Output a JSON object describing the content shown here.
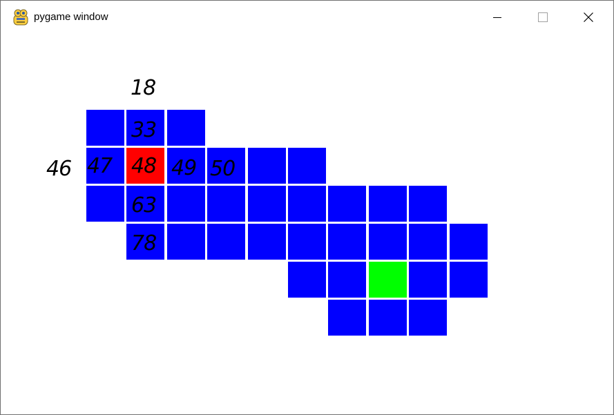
{
  "window": {
    "title": "pygame window",
    "icon": "pygame-snake-icon",
    "controls": {
      "minimize_icon": "minimize-icon",
      "maximize_icon": "maximize-icon",
      "close_icon": "close-icon"
    }
  },
  "colors": {
    "cell": "#0000ff",
    "selected": "#ff0000",
    "goal": "#00ff00",
    "background": "#ffffff",
    "gridline": "#ffffff"
  },
  "grid": {
    "rows": [
      {
        "row": 0,
        "cells": [
          {
            "col": 0,
            "state": "normal"
          },
          {
            "col": 1,
            "state": "normal"
          },
          {
            "col": 2,
            "state": "normal"
          }
        ]
      },
      {
        "row": 1,
        "cells": [
          {
            "col": 0,
            "state": "normal"
          },
          {
            "col": 1,
            "state": "selected"
          },
          {
            "col": 2,
            "state": "normal"
          },
          {
            "col": 3,
            "state": "normal"
          },
          {
            "col": 4,
            "state": "normal"
          },
          {
            "col": 5,
            "state": "normal"
          }
        ]
      },
      {
        "row": 2,
        "cells": [
          {
            "col": 0,
            "state": "normal"
          },
          {
            "col": 1,
            "state": "normal"
          },
          {
            "col": 2,
            "state": "normal"
          },
          {
            "col": 3,
            "state": "normal"
          },
          {
            "col": 4,
            "state": "normal"
          },
          {
            "col": 5,
            "state": "normal"
          },
          {
            "col": 6,
            "state": "normal"
          },
          {
            "col": 7,
            "state": "normal"
          },
          {
            "col": 8,
            "state": "normal"
          }
        ]
      },
      {
        "row": 3,
        "cells": [
          {
            "col": 1,
            "state": "normal"
          },
          {
            "col": 2,
            "state": "normal"
          },
          {
            "col": 3,
            "state": "normal"
          },
          {
            "col": 4,
            "state": "normal"
          },
          {
            "col": 5,
            "state": "normal"
          },
          {
            "col": 6,
            "state": "normal"
          },
          {
            "col": 7,
            "state": "normal"
          },
          {
            "col": 8,
            "state": "normal"
          },
          {
            "col": 9,
            "state": "normal"
          }
        ]
      },
      {
        "row": 4,
        "cells": [
          {
            "col": 5,
            "state": "normal"
          },
          {
            "col": 6,
            "state": "normal"
          },
          {
            "col": 7,
            "state": "goal"
          },
          {
            "col": 8,
            "state": "normal"
          },
          {
            "col": 9,
            "state": "normal"
          }
        ]
      },
      {
        "row": 5,
        "cells": [
          {
            "col": 6,
            "state": "normal"
          },
          {
            "col": 7,
            "state": "normal"
          },
          {
            "col": 8,
            "state": "normal"
          }
        ]
      }
    ]
  },
  "annotations": [
    {
      "text": "18",
      "name": "annotation-18"
    },
    {
      "text": "33",
      "name": "annotation-33"
    },
    {
      "text": "46",
      "name": "annotation-46"
    },
    {
      "text": "47",
      "name": "annotation-47"
    },
    {
      "text": "48",
      "name": "annotation-48"
    },
    {
      "text": "49",
      "name": "annotation-49"
    },
    {
      "text": "50",
      "name": "annotation-50"
    },
    {
      "text": "63",
      "name": "annotation-63"
    },
    {
      "text": "78",
      "name": "annotation-78"
    }
  ]
}
